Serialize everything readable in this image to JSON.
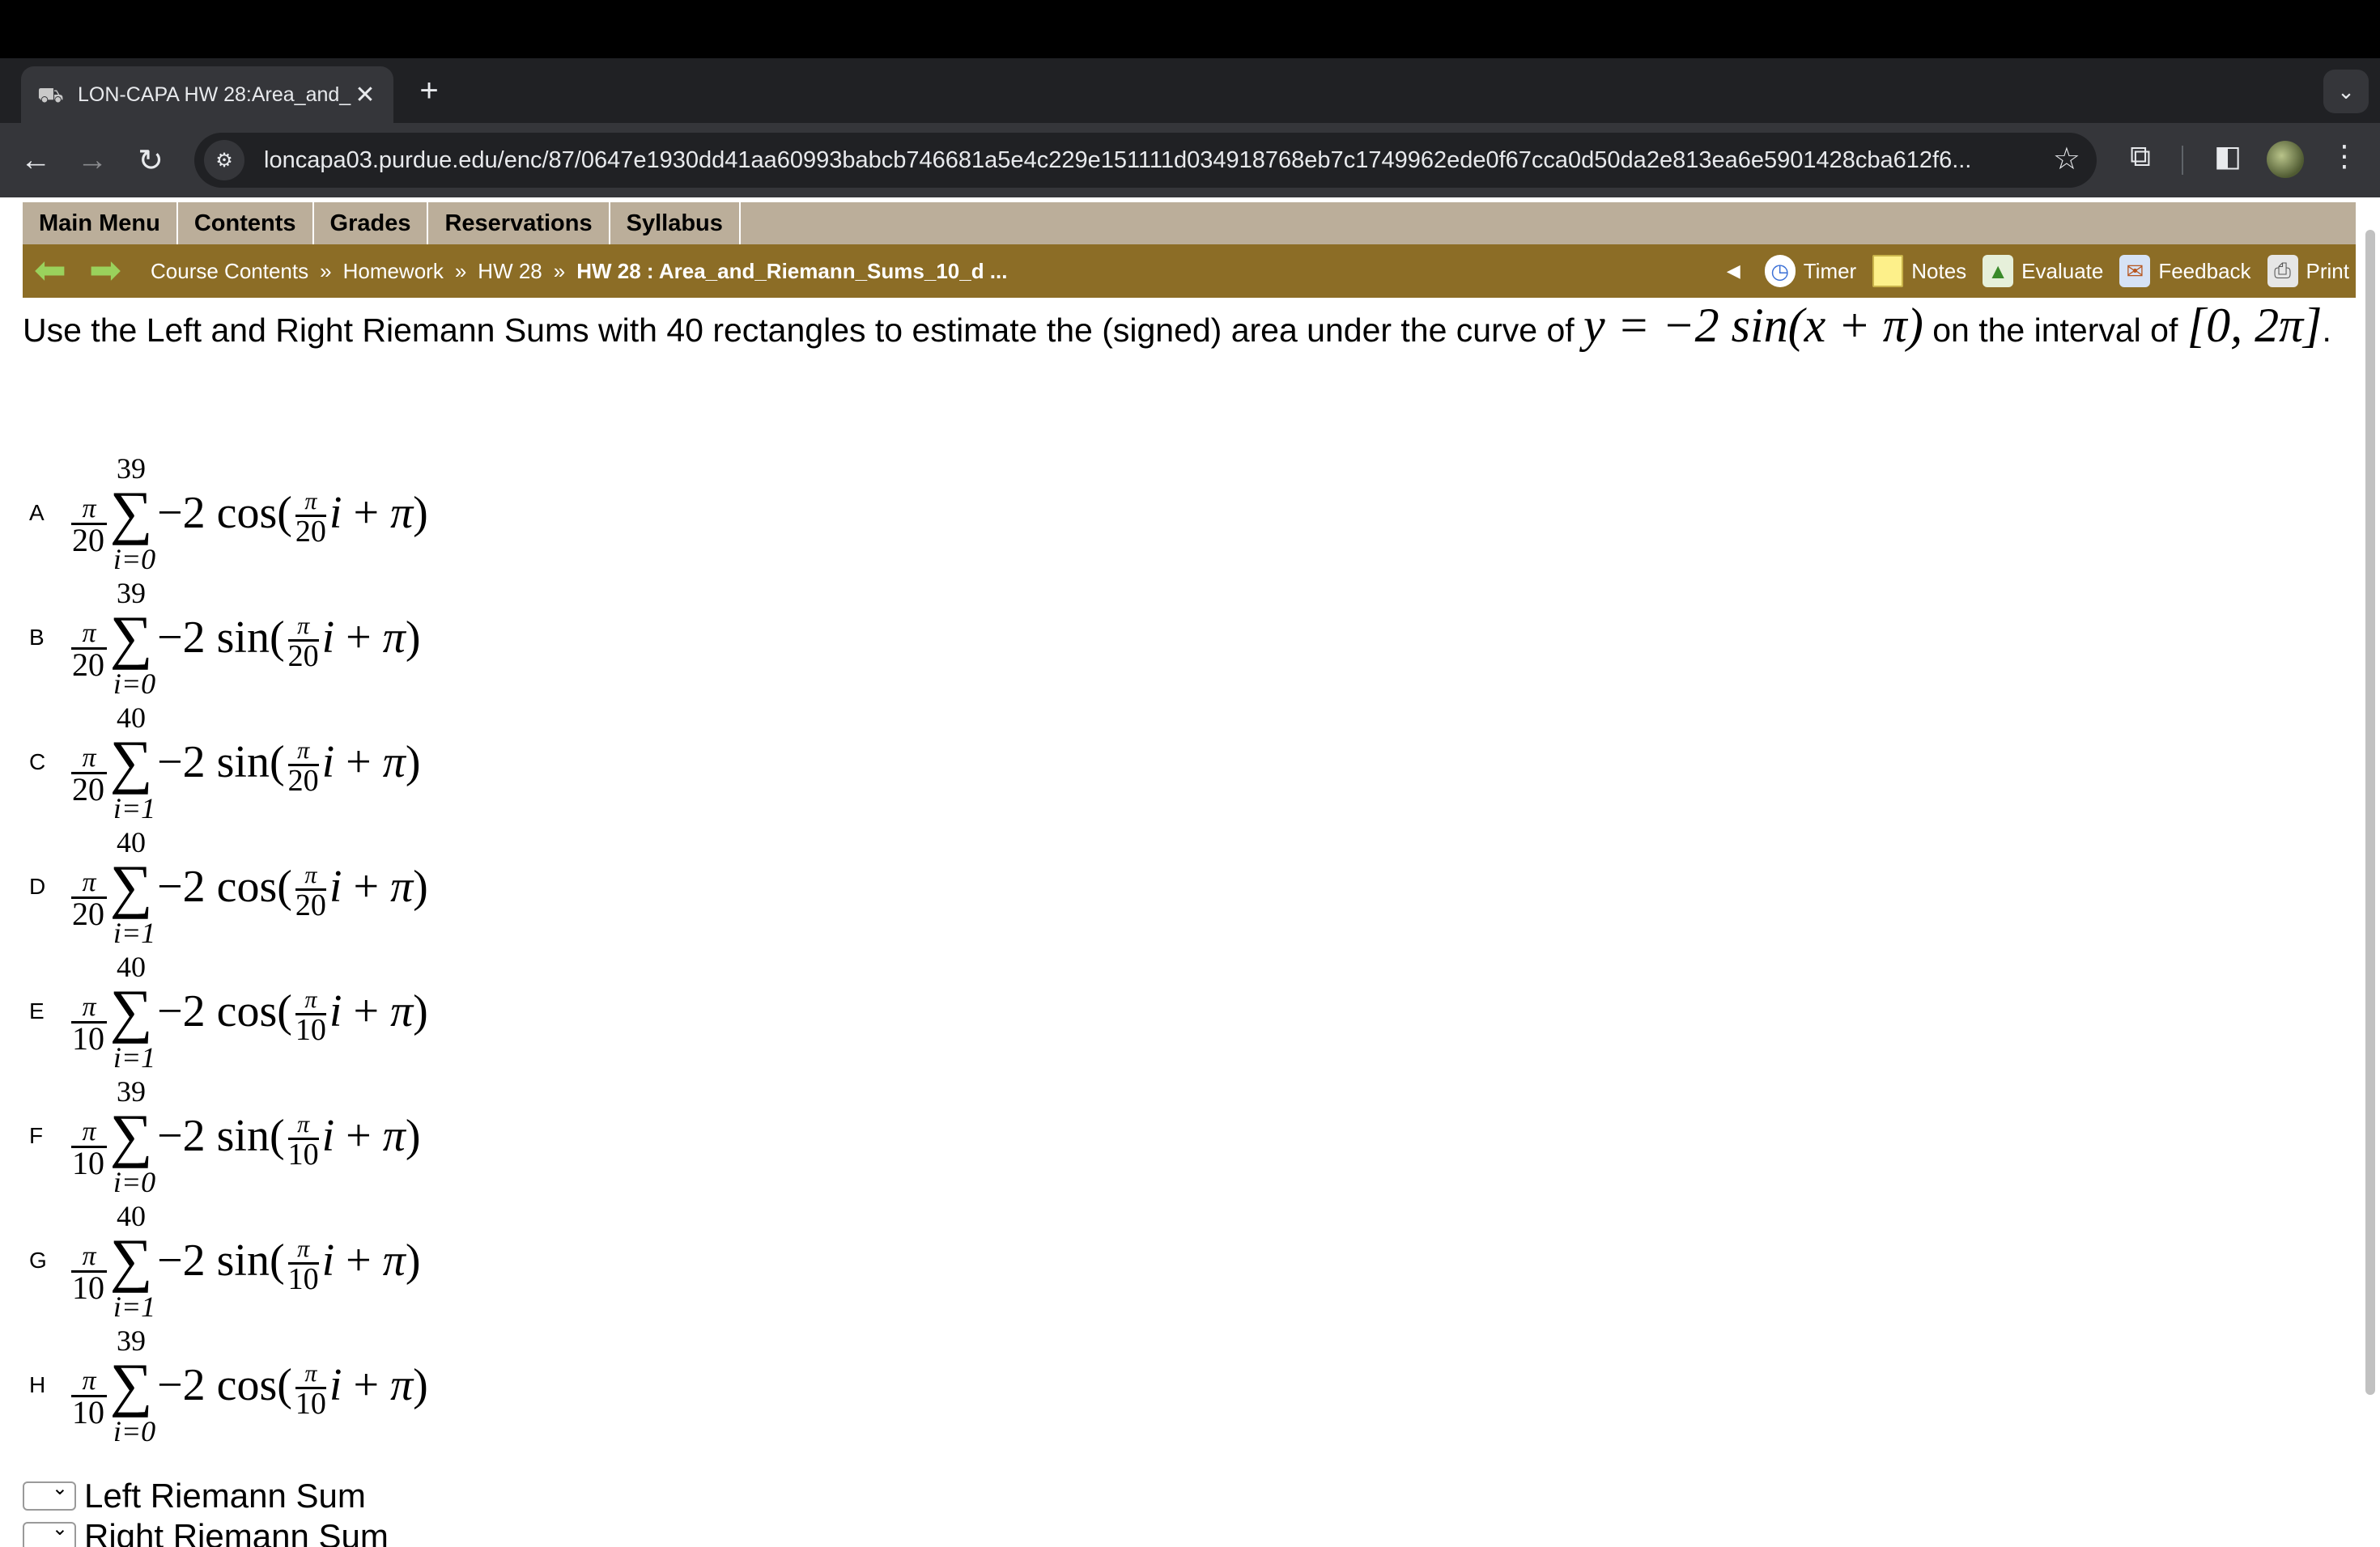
{
  "browser": {
    "tab_title": "LON-CAPA HW 28:Area_and_",
    "tab_close": "✕",
    "new_tab": "+",
    "tab_menu": "⌄",
    "url": "loncapa03.purdue.edu/enc/87/0647e1930dd41aa60993babcb746681a5e4c229e151111d034918768eb7c1749962ede0f67cca0d50da2e813ea6e5901428cba612f6..."
  },
  "menu": [
    "Main Menu",
    "Contents",
    "Grades",
    "Reservations",
    "Syllabus"
  ],
  "breadcrumb": {
    "items": [
      "Course Contents",
      "Homework",
      "HW 28"
    ],
    "separator": "»",
    "current": "HW 28 : Area_and_Riemann_Sums_10_d ..."
  },
  "tools": {
    "timer": "Timer",
    "notes": "Notes",
    "evaluate": "Evaluate",
    "feedback": "Feedback",
    "print": "Print"
  },
  "question": {
    "text_before": "Use the Left and Right Riemann Sums with 40 rectangles to estimate the (signed) area under the curve of ",
    "function": "y = −2 sin(x + π)",
    "text_middle": " on the interval of ",
    "interval": "[0, 2π]",
    "text_after": "."
  },
  "options": [
    {
      "letter": "A",
      "coef_den": "20",
      "upper": "39",
      "lower": "i=0",
      "func": "cos",
      "inner_den": "20"
    },
    {
      "letter": "B",
      "coef_den": "20",
      "upper": "39",
      "lower": "i=0",
      "func": "sin",
      "inner_den": "20"
    },
    {
      "letter": "C",
      "coef_den": "20",
      "upper": "40",
      "lower": "i=1",
      "func": "sin",
      "inner_den": "20"
    },
    {
      "letter": "D",
      "coef_den": "20",
      "upper": "40",
      "lower": "i=1",
      "func": "cos",
      "inner_den": "20"
    },
    {
      "letter": "E",
      "coef_den": "10",
      "upper": "40",
      "lower": "i=1",
      "func": "cos",
      "inner_den": "10"
    },
    {
      "letter": "F",
      "coef_den": "10",
      "upper": "39",
      "lower": "i=0",
      "func": "sin",
      "inner_den": "10"
    },
    {
      "letter": "G",
      "coef_den": "10",
      "upper": "40",
      "lower": "i=1",
      "func": "sin",
      "inner_den": "10"
    },
    {
      "letter": "H",
      "coef_den": "10",
      "upper": "39",
      "lower": "i=0",
      "func": "cos",
      "inner_den": "10"
    }
  ],
  "selects": [
    {
      "label": "Left Riemann Sum",
      "value": ""
    },
    {
      "label": "Right Riemann Sum",
      "value": ""
    }
  ]
}
